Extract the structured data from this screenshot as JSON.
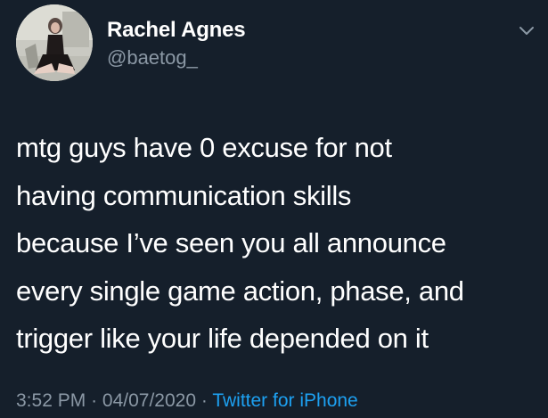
{
  "author": {
    "display_name": "Rachel Agnes",
    "handle": "@baetog_",
    "avatar_icon": "profile-photo"
  },
  "menu_icon": "chevron-down-icon",
  "tweet": {
    "lines": [
      "mtg guys have 0 excuse for not",
      "having communication skills",
      "because I’ve seen you all announce",
      "every single game action, phase, and",
      "trigger like your life depended on it"
    ]
  },
  "meta": {
    "time": "3:52 PM",
    "separator": "·",
    "date": "04/07/2020",
    "source": "Twitter for iPhone"
  },
  "colors": {
    "background": "#151f2b",
    "text": "#ffffff",
    "muted": "#8b98a5",
    "link": "#1da1f2"
  }
}
